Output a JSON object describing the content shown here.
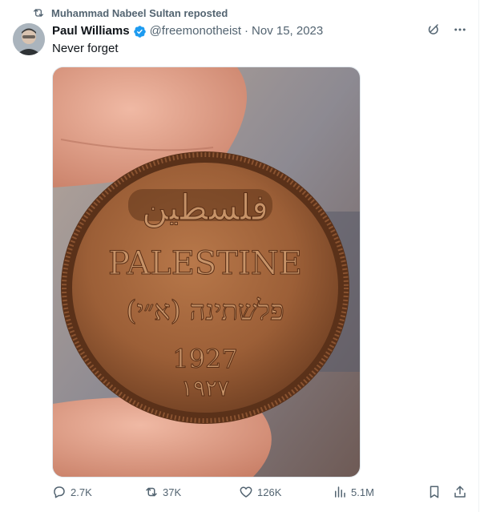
{
  "repost": {
    "text": "Muhammad Nabeel Sultan reposted",
    "icon": "repost-icon"
  },
  "author": {
    "name": "Paul Williams",
    "handle": "@freemonotheist",
    "separator": "·",
    "date": "Nov 15, 2023",
    "verified_color": "#1d9bf0"
  },
  "tweet": {
    "text": "Never forget"
  },
  "media": {
    "description_icon": "coin-photo",
    "coin_text": {
      "arabic": "فلسطين",
      "english": "PALESTINE",
      "hebrew": "פלשתינה (א״י)",
      "year": "1927",
      "year_arabic": "١٩٢٧"
    }
  },
  "actions": {
    "replies": "2.7K",
    "reposts": "37K",
    "likes": "126K",
    "views": "5.1M"
  },
  "colors": {
    "secondary_text": "#536471",
    "primary_text": "#0f1419",
    "accent": "#1d9bf0"
  }
}
